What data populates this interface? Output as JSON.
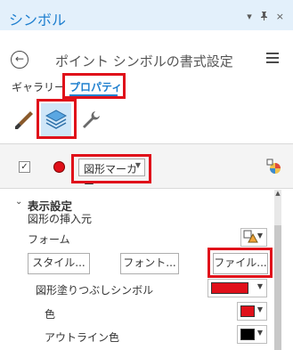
{
  "window": {
    "title": "シンボル",
    "controls": [
      "▾",
      "ㅁ",
      "×"
    ]
  },
  "header": {
    "back_icon": "arrow-left-icon",
    "title": "ポイント シンボルの書式設定",
    "menu_icon": "hamburger-icon"
  },
  "tabs": {
    "gallery": "ギャラリー",
    "properties": "プロパティ",
    "active": "properties"
  },
  "toolbar": {
    "icons": [
      "paintbrush-icon",
      "layers-icon",
      "wrench-icon"
    ],
    "active_icon": "layers-icon"
  },
  "symbol_row": {
    "checkbox": "✓",
    "marker_color": "#e0101a",
    "marker_type": "図形マーカー",
    "symbol_icon": "symbol-picker-icon"
  },
  "appearance": {
    "section_title": "表示設定",
    "insert_label": "図形の挿入元",
    "form_label": "フォーム",
    "style_button": "スタイル...",
    "font_button": "フォント...",
    "file_button": "ファイル...",
    "fill_symbol_label": "図形塗りつぶしシンボル",
    "fill_symbol_color": "#e0101a",
    "color_label": "色",
    "color_value": "#e0101a",
    "outline_color_label": "アウトライン色",
    "outline_color_value": "#000000"
  },
  "highlight_color": "#e0101a",
  "accent_color": "#1e7fcf"
}
